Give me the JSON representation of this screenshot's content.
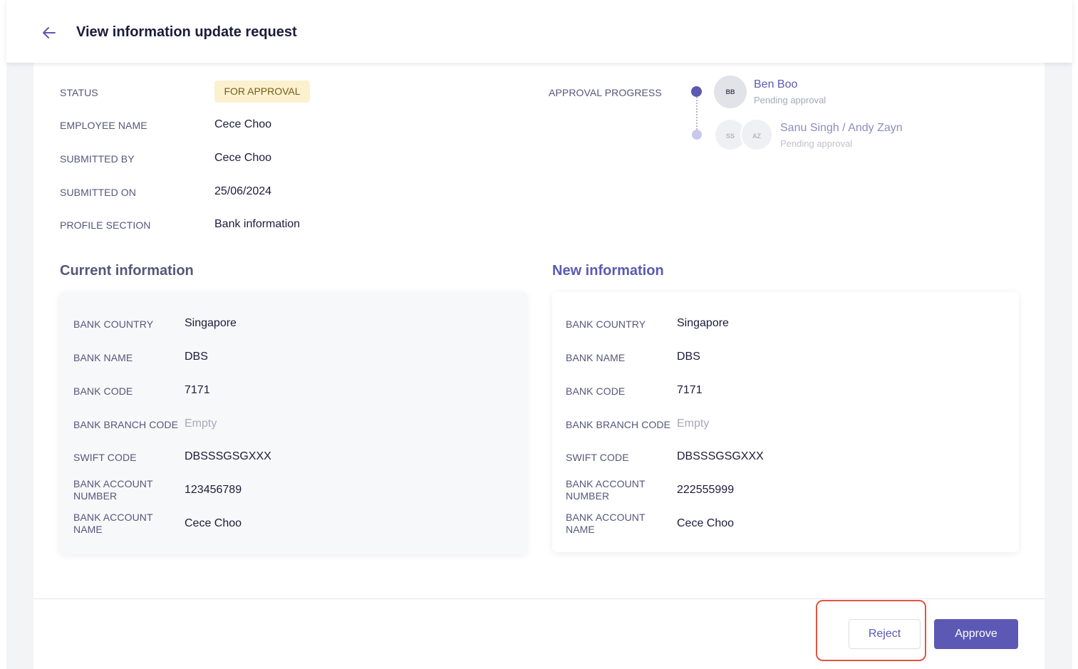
{
  "header": {
    "title": "View information update request"
  },
  "meta": {
    "status_label": "STATUS",
    "status_value": "FOR APPROVAL",
    "employee_label": "EMPLOYEE NAME",
    "employee_value": "Cece Choo",
    "submitted_by_label": "SUBMITTED BY",
    "submitted_by_value": "Cece Choo",
    "submitted_on_label": "SUBMITTED ON",
    "submitted_on_value": "25/06/2024",
    "section_label": "PROFILE SECTION",
    "section_value": "Bank information"
  },
  "approval": {
    "label": "APPROVAL PROGRESS",
    "steps": [
      {
        "initials": [
          "BB"
        ],
        "name": "Ben Boo",
        "status": "Pending approval"
      },
      {
        "initials": [
          "SS",
          "AZ"
        ],
        "name": "Sanu Singh / Andy Zayn",
        "status": "Pending approval"
      }
    ]
  },
  "current": {
    "title": "Current information",
    "rows": [
      {
        "label": "BANK COUNTRY",
        "value": "Singapore"
      },
      {
        "label": "BANK NAME",
        "value": "DBS"
      },
      {
        "label": "BANK CODE",
        "value": "7171"
      },
      {
        "label": "BANK BRANCH CODE",
        "value": "Empty"
      },
      {
        "label": "SWIFT CODE",
        "value": "DBSSSGSGXXX"
      },
      {
        "label": "BANK ACCOUNT NUMBER",
        "value": "123456789"
      },
      {
        "label": "BANK ACCOUNT NAME",
        "value": "Cece Choo"
      }
    ]
  },
  "new": {
    "title": "New information",
    "rows": [
      {
        "label": "BANK COUNTRY",
        "value": "Singapore"
      },
      {
        "label": "BANK NAME",
        "value": "DBS"
      },
      {
        "label": "BANK CODE",
        "value": "7171"
      },
      {
        "label": "BANK BRANCH CODE",
        "value": "Empty"
      },
      {
        "label": "SWIFT CODE",
        "value": "DBSSSGSGXXX"
      },
      {
        "label": "BANK ACCOUNT NUMBER",
        "value": "222555999"
      },
      {
        "label": "BANK ACCOUNT NAME",
        "value": "Cece Choo"
      }
    ]
  },
  "actions": {
    "reject_label": "Reject",
    "approve_label": "Approve"
  },
  "colors": {
    "accent": "#5b59b3",
    "status_badge_bg": "#fbf1cf",
    "status_badge_text": "#7a5a16",
    "highlight_border": "#e05543"
  },
  "icons": {
    "back": "arrow-left-icon"
  }
}
